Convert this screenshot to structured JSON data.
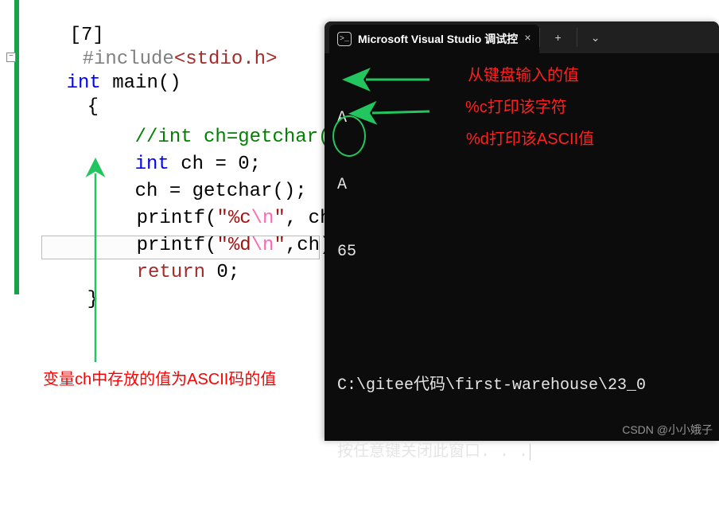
{
  "editor": {
    "line0_pre": "[7]",
    "include_kw": "#include",
    "include_open": "<",
    "include_hdr": "stdio.h",
    "include_close": ">",
    "kw_int": "int",
    "main_name": " main",
    "main_parens": "()",
    "brace_open": "{",
    "comment": "//int ch=getchar();",
    "decl_int": "int",
    "decl_rest": " ch = ",
    "decl_zero": "0",
    "decl_semi": ";",
    "assign": "ch = getchar();",
    "printf1_fn": "printf",
    "printf1_open": "(",
    "printf1_q1": "\"",
    "printf1_fmt": "%c",
    "printf1_esc": "\\n",
    "printf1_q2": "\"",
    "printf1_rest": ", ch);",
    "printf2_fn": "printf",
    "printf2_open": "(",
    "printf2_q1": "\"",
    "printf2_fmt": "%d",
    "printf2_esc": "\\n",
    "printf2_q2": "\"",
    "printf2_rest": ",ch);",
    "return_kw": "return",
    "return_rest": " 0;",
    "brace_close": "}",
    "fold_symbol": "−"
  },
  "annotations": {
    "note_var": "变量ch中存放的值为ASCII码的值",
    "note_input": "从键盘输入的值",
    "note_c": "%c打印该字符",
    "note_d": "%d打印该ASCII值"
  },
  "terminal": {
    "tab_title": "Microsoft Visual Studio 调试控",
    "plus": "+",
    "chevron": "⌄",
    "close": "×",
    "out1": "A",
    "out2": "A",
    "out3": "65",
    "path": "C:\\gitee代码\\first-warehouse\\23_0",
    "prompt": "按任意键关闭此窗口. . ."
  },
  "watermark": "CSDN @小小娥子"
}
